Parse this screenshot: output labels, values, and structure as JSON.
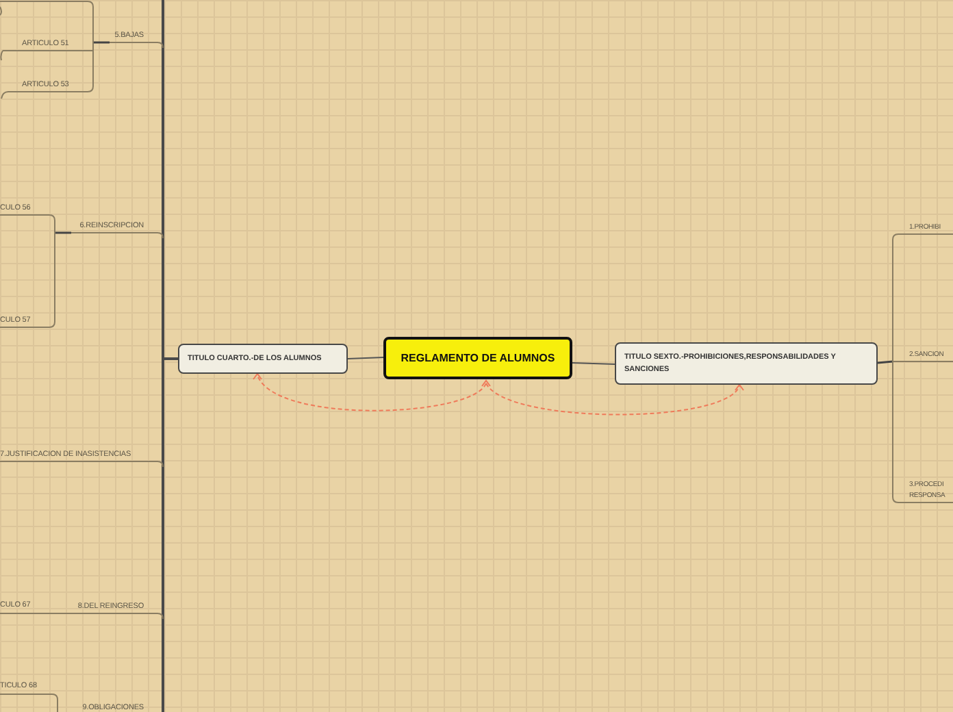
{
  "central": {
    "label": "REGLAMENTO DE ALUMNOS"
  },
  "left_branch": {
    "label": "TITULO CUARTO.-DE LOS ALUMNOS",
    "children": [
      {
        "label": "5.BAJAS",
        "children": [
          {
            "label": "ARTICULO 51"
          },
          {
            "label": "ARTICULO 53"
          }
        ]
      },
      {
        "label": "6.REINSCRIPCION",
        "children": [
          {
            "label": "CULO 56"
          },
          {
            "label": "CULO 57"
          }
        ]
      },
      {
        "label": "7.JUSTIFICACION DE INASISTENCIAS"
      },
      {
        "label": "8.DEL REINGRESO",
        "children": [
          {
            "label": "CULO 67"
          }
        ]
      },
      {
        "label": "9.OBLIGACIONES",
        "children": [
          {
            "label": "TICULO 68"
          }
        ]
      }
    ]
  },
  "right_branch": {
    "label": "TITULO SEXTO.-PROHIBICIONES,RESPONSABILIDADES Y SANCIONES",
    "children": [
      {
        "label": "1.PROHIBI"
      },
      {
        "label": "2.SANCION"
      },
      {
        "label": "3.PROCEDI\nRESPONSA"
      }
    ]
  }
}
